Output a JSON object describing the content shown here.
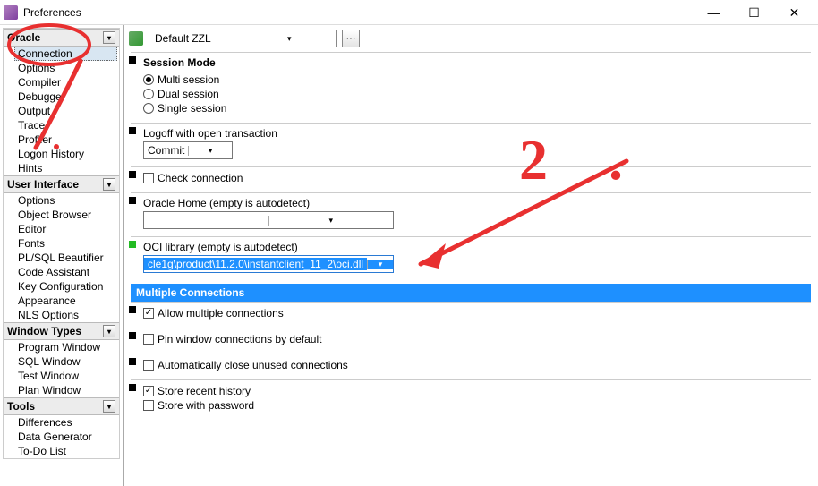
{
  "window": {
    "title": "Preferences",
    "minimize": "—",
    "maximize": "☐",
    "close": "✕"
  },
  "toolbar": {
    "profile": "Default ZZL",
    "more": "···"
  },
  "sidebar": {
    "cat0": {
      "label": "Oracle"
    },
    "cat0_items": {
      "i0": "Connection",
      "i1": "Options",
      "i2": "Compiler",
      "i3": "Debugger",
      "i4": "Output",
      "i5": "Trace",
      "i6": "Profiler",
      "i7": "Logon History",
      "i8": "Hints"
    },
    "cat1": {
      "label": "User Interface"
    },
    "cat1_items": {
      "i0": "Options",
      "i1": "Object Browser",
      "i2": "Editor",
      "i3": "Fonts",
      "i4": "PL/SQL Beautifier",
      "i5": "Code Assistant",
      "i6": "Key Configuration",
      "i7": "Appearance",
      "i8": "NLS Options"
    },
    "cat2": {
      "label": "Window Types"
    },
    "cat2_items": {
      "i0": "Program Window",
      "i1": "SQL Window",
      "i2": "Test Window",
      "i3": "Plan Window"
    },
    "cat3": {
      "label": "Tools"
    },
    "cat3_items": {
      "i0": "Differences",
      "i1": "Data Generator",
      "i2": "To-Do List"
    }
  },
  "session_mode": {
    "title": "Session Mode",
    "r0": "Multi session",
    "r1": "Dual session",
    "r2": "Single session"
  },
  "logoff": {
    "label": "Logoff with open transaction",
    "value": "Commit"
  },
  "check_conn": {
    "label": "Check connection"
  },
  "oracle_home": {
    "label": "Oracle Home (empty is autodetect)",
    "value": ""
  },
  "oci": {
    "label": "OCI library (empty is autodetect)",
    "value": "cle1g\\product\\11.2.0\\instantclient_11_2\\oci.dll"
  },
  "multiconn": {
    "header": "Multiple Connections",
    "c0": "Allow multiple connections",
    "c1": "Pin window connections by default",
    "c2": "Automatically close unused connections",
    "c3": "Store recent history",
    "c4": "Store with password"
  },
  "annotation": {
    "marker": "2",
    "dot": "."
  }
}
